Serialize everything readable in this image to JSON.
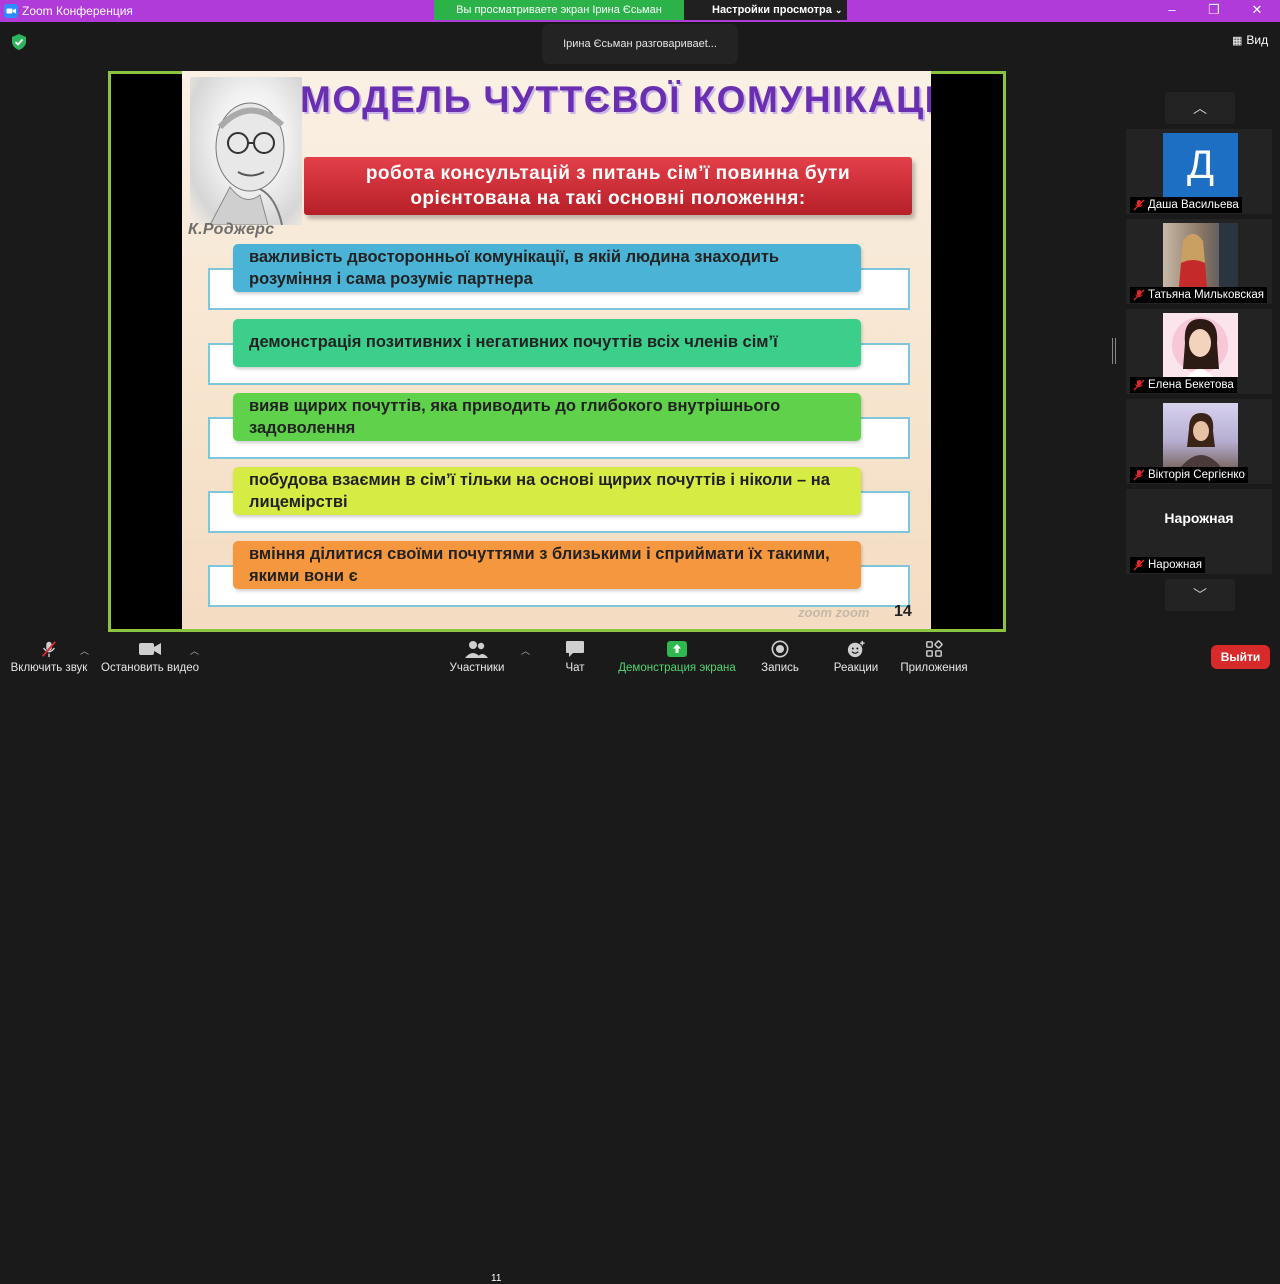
{
  "window": {
    "title": "Zoom Конференция",
    "banner": "Вы просматриваете экран Ірина Єсьман",
    "view_options": "Настройки просмотра",
    "speaker": "Ірина Єсьман разговариваеt...",
    "view_label": "Вид"
  },
  "slide": {
    "heading": "МОДЕЛЬ ЧУТТЄВОЇ КОМУНІКАЦІЇ",
    "author": "К.Роджерс",
    "subtitle_line1": "робота консультацій з питань сім’ї повинна бути",
    "subtitle_line2": "орієнтована на такі основні положення:",
    "items": [
      {
        "text": "важливість двосторонньої комунікації, в якій людина знаходить розуміння і сама розуміє партнера",
        "color": "#4bb3d6"
      },
      {
        "text": "демонстрація позитивних і негативних почуттів всіх членів сім’ї",
        "color": "#3ccf8c"
      },
      {
        "text": "вияв щирих почуттів, яка приводить до глибокого внутрішнього задоволення",
        "color": "#5fd14a"
      },
      {
        "text": "побудова взаємин в сім’ї тільки на основі щирих почуттів і ніколи – на лицемірстві",
        "color": "#d6ec45"
      },
      {
        "text": "вміння ділитися своїми почуттями з близькими і сприймати їх такими, якими вони є",
        "color": "#f5973f"
      }
    ],
    "watermark": "zoom  zoom",
    "page_number": "14"
  },
  "participants": [
    {
      "name": "Даша Васильева",
      "avatar_letter": "Д",
      "avatar_color": "#1d6fc4"
    },
    {
      "name": "Татьяна Мильковская"
    },
    {
      "name": "Елена Бекетова"
    },
    {
      "name": "Вікторія Сергієнко"
    },
    {
      "name": "Нарожная",
      "display_name": "Нарожная"
    }
  ],
  "toolbar": {
    "mute": "Включить звук",
    "video": "Остановить видео",
    "participants": "Участники",
    "participants_count": "11",
    "chat": "Чат",
    "share": "Демонстрация экрана",
    "record": "Запись",
    "reactions": "Реакции",
    "apps": "Приложения",
    "leave": "Выйти"
  }
}
